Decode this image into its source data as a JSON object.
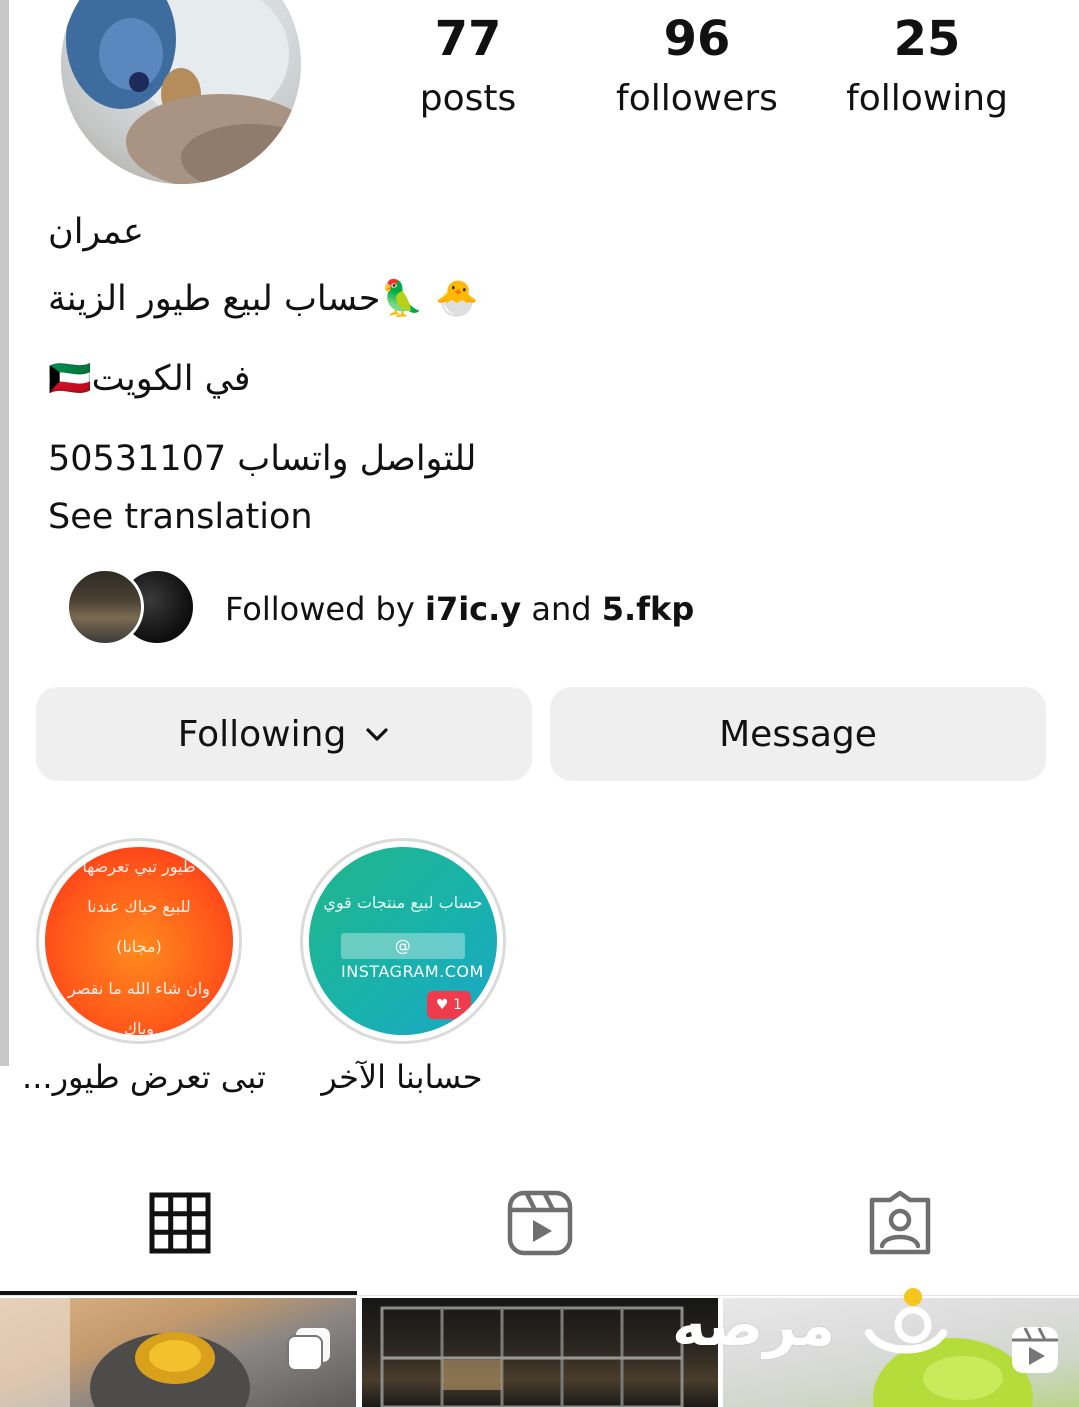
{
  "profile": {
    "avatar_alt": "avatar"
  },
  "stats": {
    "posts": {
      "value": "77",
      "label": "posts"
    },
    "followers": {
      "value": "96",
      "label": "followers"
    },
    "following": {
      "value": "25",
      "label": "following"
    }
  },
  "bio": {
    "name": "عمران",
    "line1": "🐣 🦜حساب لبيع طيور الزينة",
    "line2": "🇰🇼في الكويت",
    "line3": "للتواصل واتساب 50531107",
    "see_translation": "See translation"
  },
  "followed_by": {
    "prefix": "Followed by ",
    "user1": "i7ic.y",
    "joiner": " and ",
    "user2": "5.fkp"
  },
  "actions": {
    "following_label": "Following",
    "message_label": "Message"
  },
  "highlights": [
    {
      "label": "تبى تعرض طيور...",
      "lines": [
        "طيور تبي تعرضها",
        "للبيع حياك عندنا",
        "(مجانا)",
        "وان شاء الله ما نقصر",
        "وياك"
      ]
    },
    {
      "label": "حسابنا الآخر",
      "lines": [
        "حساب لبيع منتجات قوي"
      ],
      "pill": "@ INSTAGRAM.COM",
      "likes": "♥ 1"
    }
  ],
  "tabs": [
    {
      "name": "grid",
      "icon": "grid-icon",
      "active": true
    },
    {
      "name": "reels",
      "icon": "reels-icon",
      "active": false
    },
    {
      "name": "tagged",
      "icon": "tagged-icon",
      "active": false
    }
  ],
  "watermark": {
    "text": "مرصه"
  },
  "colors": {
    "button_bg": "#efefef",
    "highlight1": "#ff5a1a",
    "highlight2": "#19b3a8"
  }
}
